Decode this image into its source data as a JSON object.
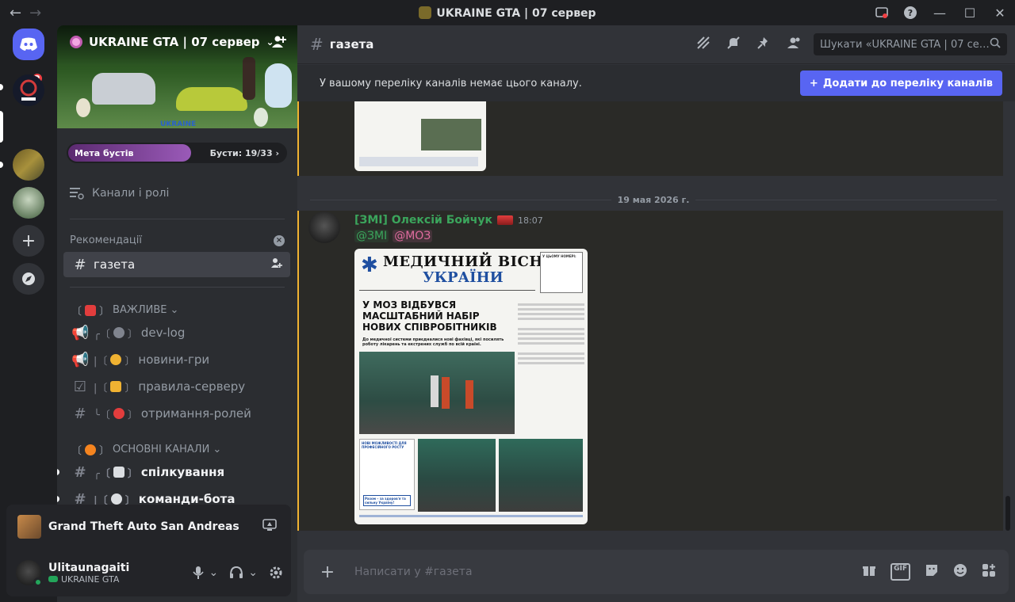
{
  "window": {
    "title": "UKRAINE GTA | 07 сервер"
  },
  "rail": {
    "home_badge": "2"
  },
  "server": {
    "name": "UKRAINE GTA | 07 сервер",
    "banner_text": "UKRAINE",
    "boost_goal_label": "Мета бустів",
    "boost_count": "Бусти: 19/33"
  },
  "sidebar": {
    "channels_roles": "Канали і ролі",
    "recommendations": "Рекомендації",
    "recommended_channel": "газета",
    "categories": [
      {
        "label": "ВАЖЛИВЕ"
      },
      {
        "label": "ОСНОВНІ КАНАЛИ"
      }
    ],
    "channels": [
      {
        "name": "dev-log",
        "prefix": "╭〔",
        "emoji_color": "#80848e"
      },
      {
        "name": "новини-гри",
        "prefix": "|〔",
        "emoji_color": "#f0b232"
      },
      {
        "name": "правила-серверу",
        "prefix": "|〔",
        "emoji_color": "#f0b232"
      },
      {
        "name": "отримання-ролей",
        "prefix": "╰〔",
        "emoji_color": "#e23d3d"
      },
      {
        "name": "спілкування",
        "prefix": "╭〔",
        "emoji_color": "#dbdee1"
      },
      {
        "name": "команди-бота",
        "prefix": "|〔",
        "emoji_color": "#dbdee1"
      }
    ]
  },
  "activity": {
    "game": "Grand Theft Auto San Andreas"
  },
  "user": {
    "name": "Ulitaunagaiti",
    "status": "UKRAINE GTA"
  },
  "channel": {
    "name": "газета",
    "search_placeholder": "Шукати «UKRAINE GTA | 07 сервер»"
  },
  "notice": {
    "text": "У вашому переліку каналів немає цього каналу.",
    "button": "Додати до переліку каналів"
  },
  "date_divider": "19 мая 2026 г.",
  "message": {
    "author": "[ЗМІ] Олексій Бойчук",
    "time": "18:07",
    "mention1": "@ЗМІ",
    "mention2": "@МОЗ"
  },
  "newspaper": {
    "title": "МЕДИЧНИЙ ВІСНИК",
    "subtitle": "УКРАЇНИ",
    "box_title": "У ЦЬОМУ НОМЕРІ:",
    "headline": "У МОЗ ВІДБУВСЯ МАСШТАБНИЙ НАБІР НОВИХ СПІВРОБІТНИКІВ",
    "lead": "До медичної системи приєдналися нові фахівці, які посилять роботу лікарень та екстрених служб по всій країні.",
    "side_title": "НОВІ МОЖЛИВОСТІ ДЛЯ ПРОФЕСІЙНОГО РОСТУ",
    "slogan": "Разом – за здоров'я та сильну Україну!"
  },
  "composer": {
    "placeholder": "Написати у #газета"
  },
  "colors": {
    "accent": "#5865f2",
    "online": "#23a55a",
    "author_green": "#3ba55c",
    "mention_pink": "#e06c9f",
    "highlight": "#f0b232"
  }
}
